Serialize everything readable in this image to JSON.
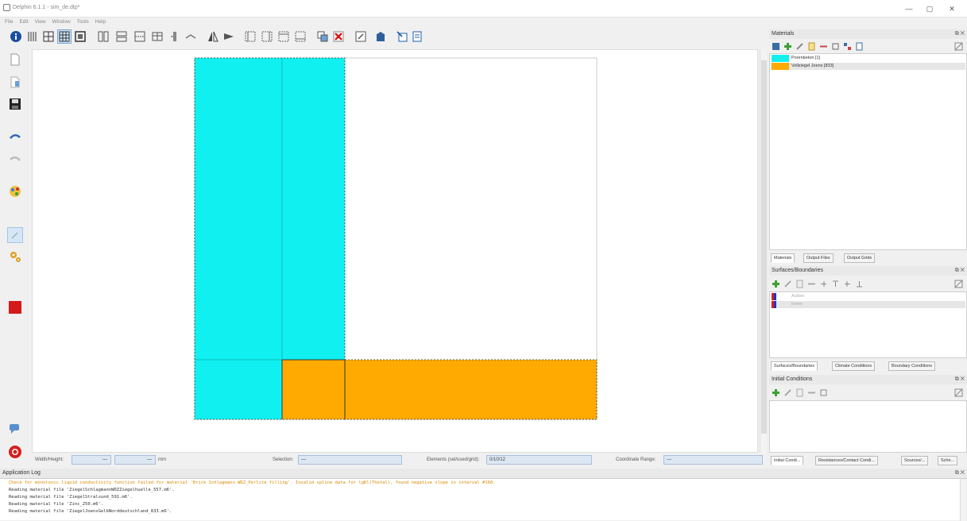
{
  "window": {
    "title": "Delphin 6.1.1 - sim_de.dtp*",
    "controls": [
      "—",
      "▢",
      "✕"
    ]
  },
  "menu": [
    "File",
    "Edit",
    "View",
    "Window",
    "Tools",
    "Help"
  ],
  "statusbar": {
    "width_height_label": "Width/Height:",
    "width_value": "—",
    "height_value": "—",
    "unit": "mm",
    "selection_label": "Selection:",
    "selection_value": "—",
    "elements_label": "Elements (sel/used/grid):",
    "elements_value": "0/10/12",
    "coord_label": "Coordinate Range:",
    "coord_value": "—"
  },
  "materials_panel": {
    "title": "Materials",
    "items": [
      {
        "label": "Porenbeton [1]",
        "color": "#10f0f0"
      },
      {
        "label": "Vollziegel Joens [833]",
        "color": "#ffaa00"
      }
    ],
    "tabs": [
      "Materials",
      "Output Files",
      "Output Grids"
    ]
  },
  "surfaces_panel": {
    "title": "Surfaces/Boundaries",
    "items": [
      {
        "label": "Außen"
      },
      {
        "label": "Innen"
      }
    ],
    "tabs": [
      "Surfaces/Boundaries",
      "Climate Conditions",
      "Boundary Conditions"
    ]
  },
  "initial_panel": {
    "title": "Initial Conditions",
    "tabs": [
      "Initial Condi...",
      "Resistances/Contact Condi...",
      "Sources/...",
      "Sche..."
    ]
  },
  "log": {
    "title": "Application Log",
    "lines": [
      {
        "text": "Check for monotonic liquid conductivity function failed for material 'Brick Schlagmann WDZ_Perlite filling'. Invalid spline data for lgKl(Thetal), found negative slope in interval #160.",
        "color": "#d98a00"
      },
      {
        "text": "Reading material file 'ZiegelSchlagmannWDZZiegelhuelle_557.m6'.",
        "color": "#333333"
      },
      {
        "text": "Reading material file 'ZiegelStralsund_591.m6'.",
        "color": "#333333"
      },
      {
        "text": "Reading material file 'Zinc_250.m6'.",
        "color": "#333333"
      },
      {
        "text": "Reading material file 'ZiegelJoensGelbNorddeutschland_833.m6'.",
        "color": "#333333"
      }
    ]
  },
  "colors": {
    "porenbeton": "#10f0f0",
    "vollziegel": "#ffaa00"
  }
}
